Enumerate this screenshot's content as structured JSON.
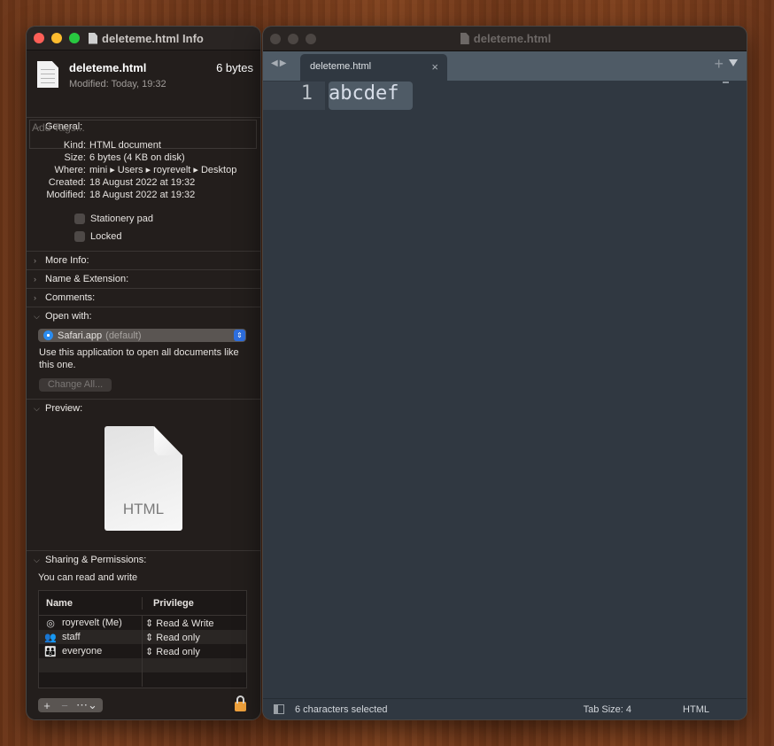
{
  "info_window": {
    "title": "deleteme.html Info",
    "file_name": "deleteme.html",
    "file_size": "6 bytes",
    "modified_summary": "Modified: Today, 19:32",
    "tags_placeholder": "Add Tags...",
    "general": {
      "header": "General:",
      "rows": [
        {
          "key": "Kind:",
          "value": "HTML document"
        },
        {
          "key": "Size:",
          "value": "6 bytes (4 KB on disk)"
        },
        {
          "key": "Where:",
          "value": "mini ▸ Users ▸ royrevelt ▸ Desktop"
        },
        {
          "key": "Created:",
          "value": "18 August 2022 at 19:32"
        },
        {
          "key": "Modified:",
          "value": "18 August 2022 at 19:32"
        }
      ],
      "stationery_pad": "Stationery pad",
      "locked": "Locked"
    },
    "collapsed_sections": [
      "More Info:",
      "Name & Extension:",
      "Comments:"
    ],
    "open_with": {
      "header": "Open with:",
      "app": "Safari.app",
      "app_suffix": "(default)",
      "description": "Use this application to open all documents like this one.",
      "change_all": "Change All..."
    },
    "preview": {
      "header": "Preview:",
      "label": "HTML"
    },
    "sharing": {
      "header": "Sharing & Permissions:",
      "summary": "You can read and write",
      "columns": [
        "Name",
        "Privilege"
      ],
      "rows": [
        {
          "icon": "user-icon",
          "glyph": "◎",
          "name": "royrevelt (Me)",
          "privilege": "Read & Write"
        },
        {
          "icon": "group-icon",
          "glyph": "👥",
          "name": "staff",
          "privilege": "Read only"
        },
        {
          "icon": "everyone-icon",
          "glyph": "👪",
          "name": "everyone",
          "privilege": "Read only"
        }
      ],
      "tools": {
        "add": "+",
        "remove": "−",
        "more": "⋯⌄"
      }
    }
  },
  "editor_window": {
    "title": "deleteme.html",
    "tab_label": "deleteme.html",
    "line_number": "1",
    "code_line": "abcdef",
    "status": {
      "selection": "6 characters selected",
      "tab_size": "Tab Size: 4",
      "syntax": "HTML"
    }
  }
}
